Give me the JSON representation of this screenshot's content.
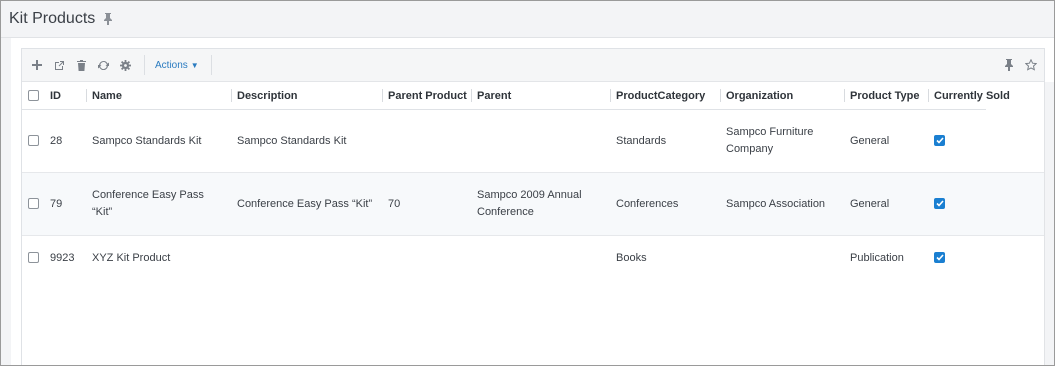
{
  "page": {
    "title": "Kit Products"
  },
  "toolbar": {
    "actions_label": "Actions"
  },
  "table": {
    "columns": [
      "ID",
      "Name",
      "Description",
      "Parent Product",
      "Parent",
      "ProductCategory",
      "Organization",
      "Product Type",
      "Currently Sold"
    ],
    "rows": [
      {
        "id": "28",
        "name": "Sampco Standards Kit",
        "description": "Sampco Standards Kit",
        "parent_product": "",
        "parent": "",
        "category": "Standards",
        "organization": "Sampco Furniture Company",
        "type": "General",
        "sold": true
      },
      {
        "id": "79",
        "name": "Conference Easy Pass “Kit”",
        "description": "Conference Easy Pass “Kit”",
        "parent_product": "70",
        "parent": "Sampco 2009 Annual Conference",
        "category": "Conferences",
        "organization": "Sampco Association",
        "type": "General",
        "sold": true
      },
      {
        "id": "9923",
        "name": "XYZ Kit Product",
        "description": "",
        "parent_product": "",
        "parent": "",
        "category": "Books",
        "organization": "",
        "type": "Publication",
        "sold": true
      }
    ]
  },
  "colors": {
    "accent": "#1a7fd1",
    "link": "#2a7bc0"
  }
}
